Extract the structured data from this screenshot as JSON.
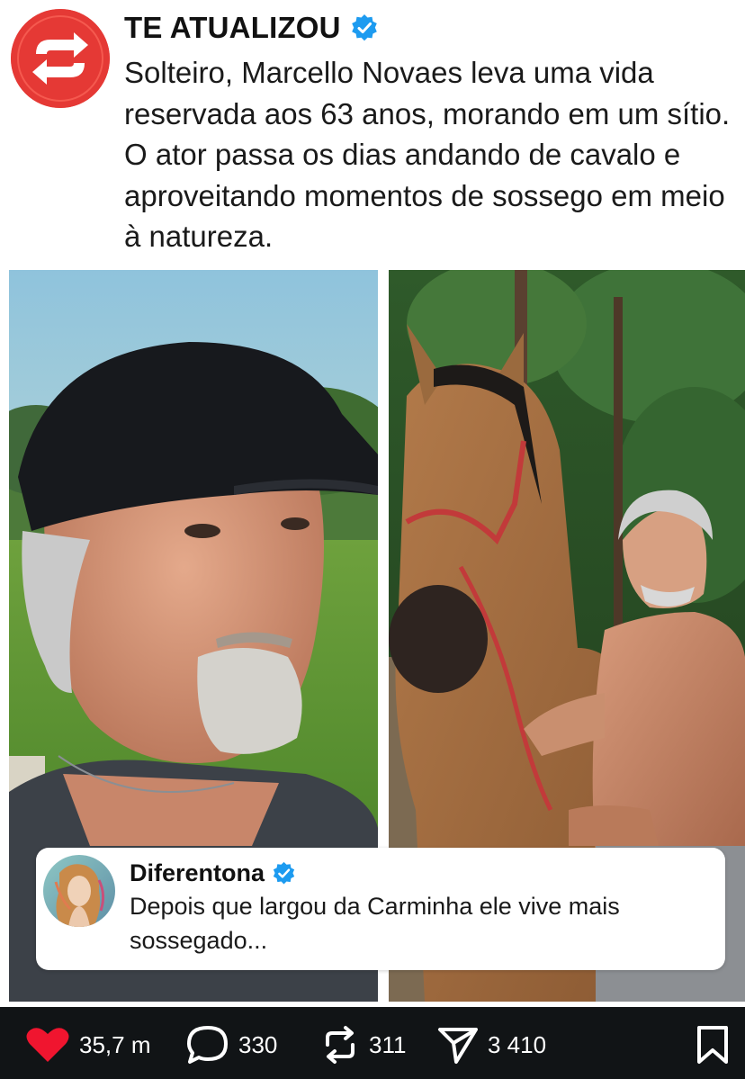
{
  "post": {
    "author": "TE ATUALIZOU",
    "avatar_icon": "repost-arrows-icon",
    "verified_icon": "verified-badge-icon",
    "text": "Solteiro, Marcello Novaes leva uma vida reservada aos 63 anos, morando em um sítio. O ator passa os dias andando de cavalo e aproveitando momentos de sossego em meio à natureza."
  },
  "images": [
    {
      "subject": "man-in-black-cap-selfie"
    },
    {
      "subject": "shirtless-man-with-horse"
    }
  ],
  "reply": {
    "author": "Diferentona",
    "text": "Depois que largou da Carminha ele vive mais sossegado..."
  },
  "actions": {
    "likes": "35,7 m",
    "comments": "330",
    "reposts": "311",
    "shares": "3 410"
  },
  "colors": {
    "brand_red": "#e53935",
    "verified_blue": "#1d9bf0",
    "like_red": "#f0152f",
    "action_bar": "#111416"
  }
}
